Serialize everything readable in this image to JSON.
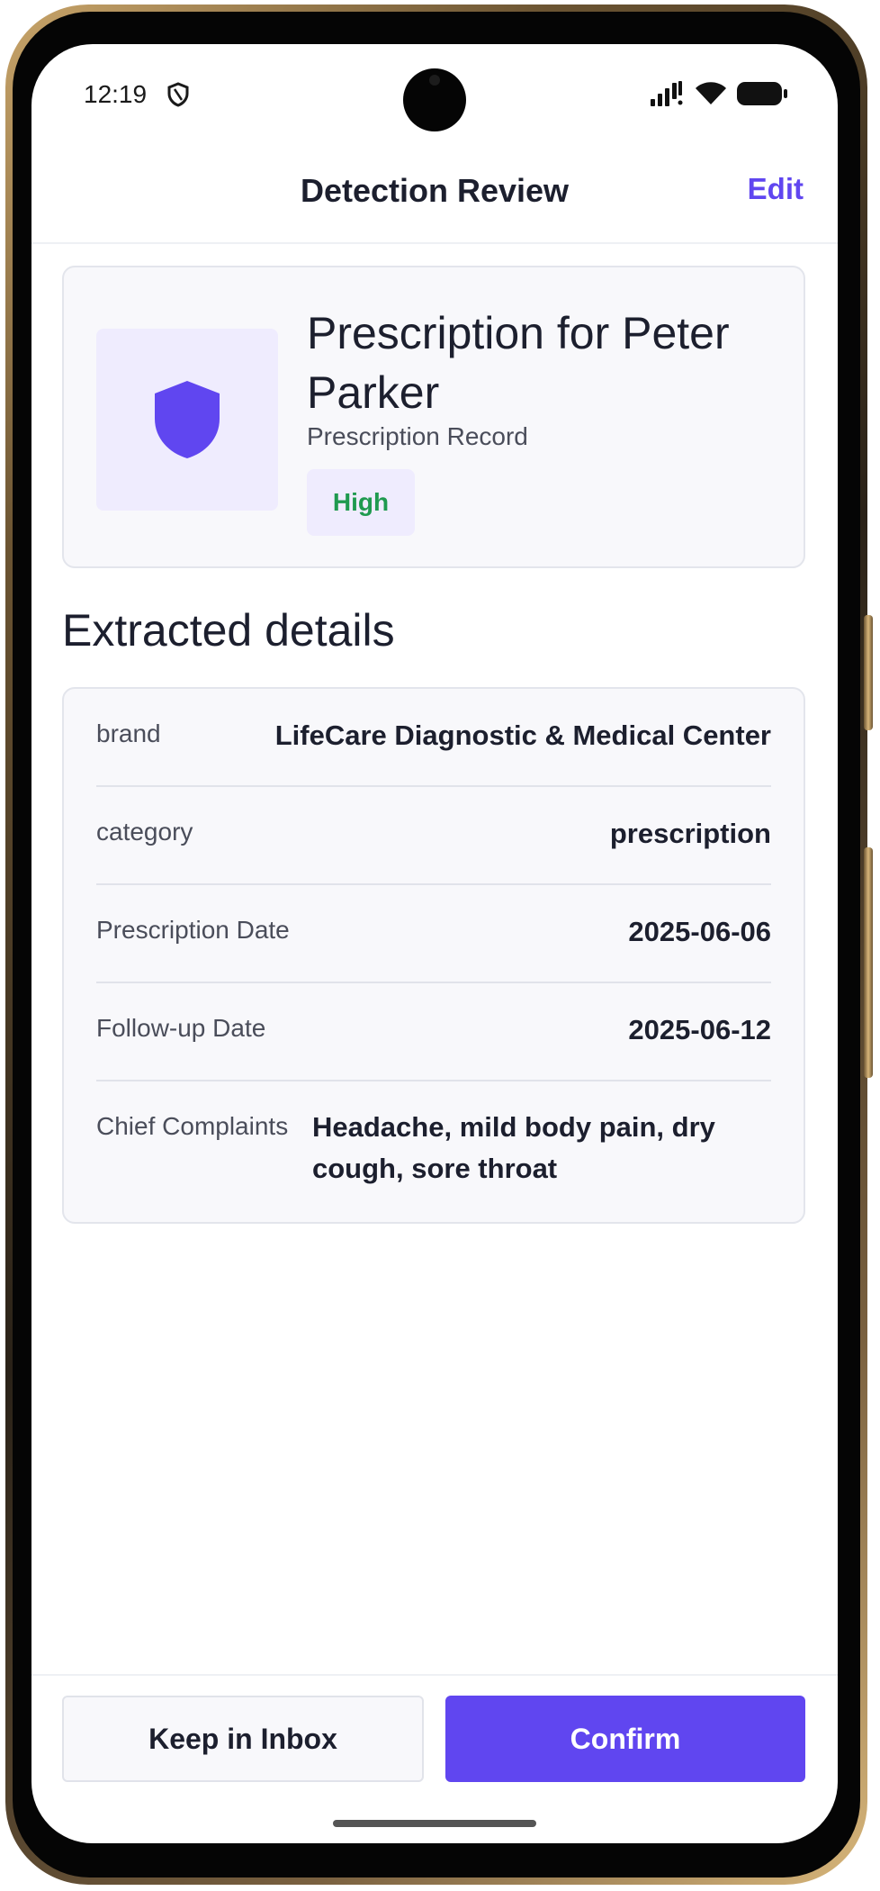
{
  "status_bar": {
    "time": "12:19"
  },
  "header": {
    "title": "Detection Review",
    "edit_label": "Edit"
  },
  "summary": {
    "title": "Prescription for Peter Parker",
    "subtitle": "Prescription Record",
    "confidence": "High",
    "icon": "shield-icon"
  },
  "details_section": {
    "title": "Extracted details",
    "rows": [
      {
        "label": "brand",
        "value": "LifeCare Diagnostic & Medical Center"
      },
      {
        "label": "category",
        "value": "prescription"
      },
      {
        "label": "Prescription Date",
        "value": "2025-06-06"
      },
      {
        "label": "Follow-up Date",
        "value": "2025-06-12"
      },
      {
        "label": "Chief Complaints",
        "value": "Headache, mild body pain, dry cough, sore throat"
      }
    ]
  },
  "actions": {
    "secondary_label": "Keep in Inbox",
    "primary_label": "Confirm"
  },
  "colors": {
    "accent": "#6046f0",
    "confidence_high": "#1f9a4f",
    "card_bg": "#f8f8fb"
  }
}
